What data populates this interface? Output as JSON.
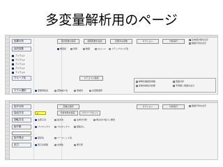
{
  "slide": {
    "title": "多変量解析用のページ"
  },
  "sheet1": {
    "row_label_1": "因果分析",
    "row_label_2": "目的変数",
    "buttons": [
      "目的変数の指定",
      "説明変数を追加",
      "定義済み変数",
      "オプション",
      "分析実行"
    ],
    "mode_options": [
      {
        "label": "重回帰",
        "selected": true
      },
      {
        "label": "判別",
        "selected": false
      },
      {
        "label": "数量",
        "selected": false
      },
      {
        "label": "ロジット",
        "selected": false
      },
      {
        "label": "ステップワイズ法",
        "selected": false
      }
    ],
    "navy_items": [
      "アイテム1",
      "アイテム2",
      "アイテム3",
      "アイテム4",
      "アイテム5"
    ],
    "mid_label": "グループ化",
    "mid_button": "カテゴリに追加",
    "bottom_label": "モデル選択",
    "bottom_options": [
      {
        "label": "変数増加法",
        "selected": true
      },
      {
        "label": "変数減少法",
        "selected": false
      },
      {
        "label": "増減法",
        "selected": false
      },
      {
        "label": "全変数選択",
        "selected": false
      }
    ],
    "right_checks": [
      {
        "label": "基本統計量を表示",
        "checked": true
      },
      {
        "label": "相関行列を表示",
        "checked": false
      }
    ],
    "bottom_right_checks": [
      {
        "label": "標準化偏回帰係数",
        "checked": false
      },
      {
        "label": "残差分析",
        "checked": false
      },
      {
        "label": "多重共線性の診断",
        "checked": false
      },
      {
        "label": "予測値と残差を出力",
        "checked": false
      }
    ]
  },
  "sheet2": {
    "row_label_1": "因子分析",
    "buttons": [
      "変数の選択",
      "オプション",
      "分析実行"
    ],
    "sub_buttons": [
      "分析対象を指定",
      "スクリープロット"
    ],
    "row_labels": [
      "抽出方法",
      "回転方法",
      "因子数",
      "因子得点",
      "出力"
    ],
    "row_values": [
      "2",
      "",
      "",
      "",
      ""
    ],
    "method_options": [
      {
        "label": "主因子法",
        "selected": true
      },
      {
        "label": "最尤法",
        "selected": false
      },
      {
        "label": "主成分分析",
        "selected": false
      },
      {
        "label": "重み付け最小二乗法",
        "selected": false
      }
    ],
    "rotation_options": [
      {
        "label": "バリマックス",
        "selected": true
      },
      {
        "label": "プロマックス",
        "selected": false
      },
      {
        "label": "回転なし",
        "selected": false
      }
    ],
    "score_options": [
      {
        "label": "回帰法",
        "selected": true
      },
      {
        "label": "バートレット法",
        "selected": false
      }
    ],
    "output_options": [
      {
        "label": "因子負荷量",
        "selected": true
      },
      {
        "label": "共通性",
        "selected": false
      },
      {
        "label": "寄与率",
        "selected": false
      }
    ],
    "right_checks": [
      {
        "label": "相関行列を表示",
        "checked": false
      }
    ]
  }
}
